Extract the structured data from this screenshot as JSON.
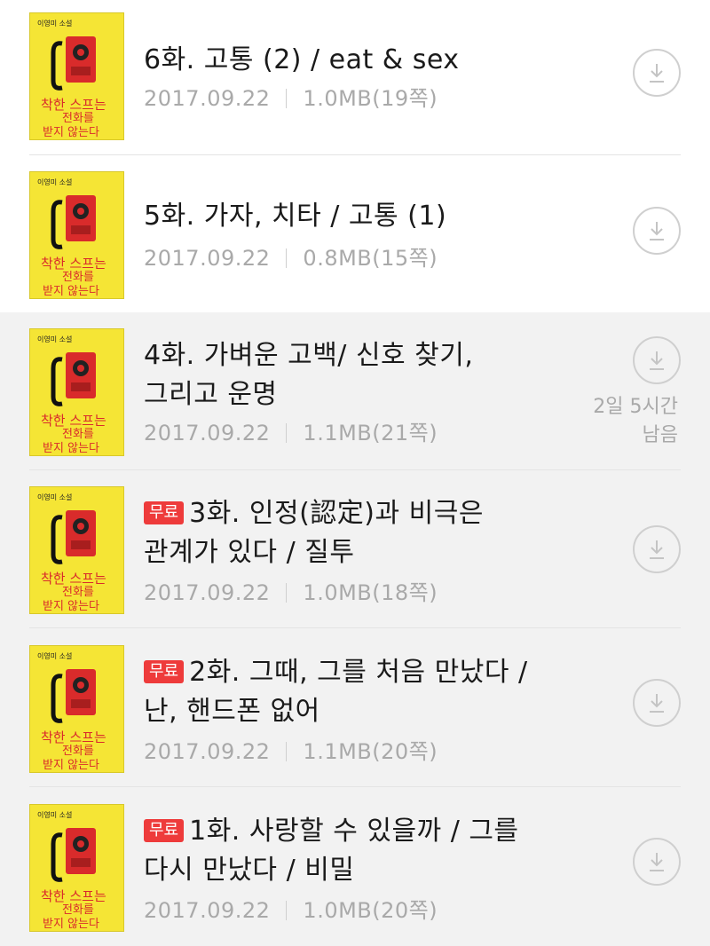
{
  "episodes": [
    {
      "title_line1": "6화. 고통 (2) / eat & sex",
      "title_line2": "",
      "badge": "",
      "date": "2017.09.22",
      "size": "1.0MB(19쪽)",
      "remaining_line1": "",
      "remaining_line2": ""
    },
    {
      "title_line1": "5화. 가자, 치타 / 고통 (1)",
      "title_line2": "",
      "badge": "",
      "date": "2017.09.22",
      "size": "0.8MB(15쪽)",
      "remaining_line1": "",
      "remaining_line2": ""
    },
    {
      "title_line1": "4화. 가벼운 고백/ 신호 찾기,",
      "title_line2": "그리고 운명",
      "badge": "",
      "date": "2017.09.22",
      "size": "1.1MB(21쪽)",
      "remaining_line1": "2일 5시간",
      "remaining_line2": "남음"
    },
    {
      "title_line1": "3화. 인정(認定)과 비극은",
      "title_line2": "관계가 있다 / 질투",
      "badge": "무료",
      "date": "2017.09.22",
      "size": "1.0MB(18쪽)",
      "remaining_line1": "",
      "remaining_line2": ""
    },
    {
      "title_line1": "2화. 그때, 그를 처음 만났다 /",
      "title_line2": "난, 핸드폰 없어",
      "badge": "무료",
      "date": "2017.09.22",
      "size": "1.1MB(20쪽)",
      "remaining_line1": "",
      "remaining_line2": ""
    },
    {
      "title_line1": "1화. 사랑할 수 있을까 / 그를",
      "title_line2": "다시 만났다 / 비밀",
      "badge": "무료",
      "date": "2017.09.22",
      "size": "1.0MB(20쪽)",
      "remaining_line1": "",
      "remaining_line2": ""
    }
  ],
  "cover": {
    "author": "이영미 소설",
    "title_line1": "착한 스프는",
    "title_line2": "전화를",
    "title_line3": "받지 않는다"
  },
  "colors": {
    "cover_yellow": "#f5e535",
    "phone_red": "#d92b2b",
    "badge_red": "#ee3b3b",
    "muted_text": "#a9a9a9",
    "gray_row_bg": "#f2f2f2"
  },
  "icons": {
    "download": "download-icon"
  }
}
